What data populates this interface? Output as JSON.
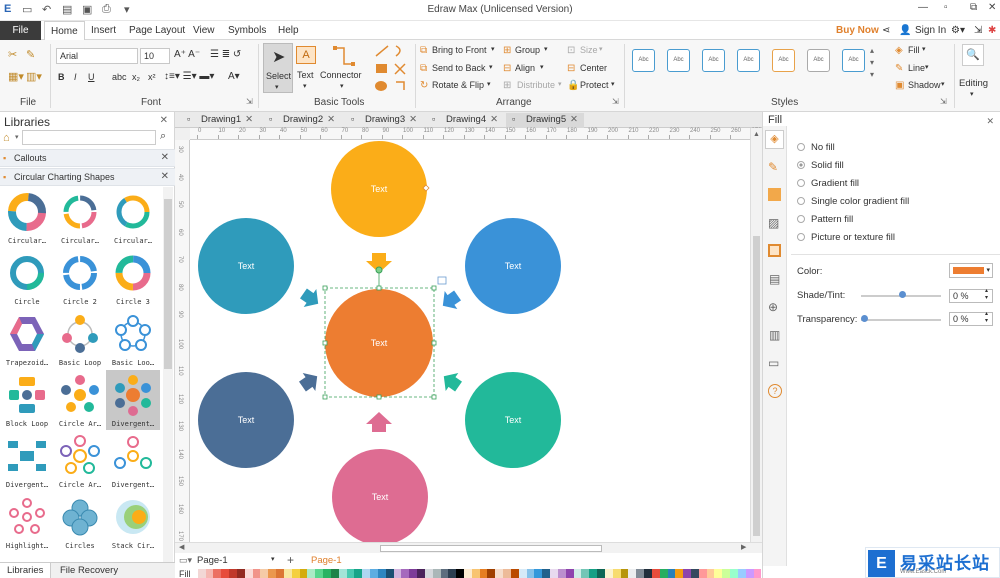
{
  "window": {
    "title": "Edraw Max (Unlicensed Version)"
  },
  "menu": {
    "file": "File",
    "items": [
      "Home",
      "Insert",
      "Page Layout",
      "View",
      "Symbols",
      "Help"
    ],
    "buy_now": "Buy Now",
    "sign_in": "Sign In"
  },
  "ribbon": {
    "font_name": "Arial",
    "font_size": "10",
    "group_file": "File",
    "group_font": "Font",
    "group_basic_tools": "Basic Tools",
    "group_arrange": "Arrange",
    "group_styles": "Styles",
    "group_editing": "Editing",
    "select": "Select",
    "text": "Text",
    "connector": "Connector",
    "bring_to_front": "Bring to Front",
    "send_to_back": "Send to Back",
    "rotate_flip": "Rotate & Flip",
    "group": "Group",
    "align": "Align",
    "distribute": "Distribute",
    "size": "Size",
    "center": "Center",
    "protect": "Protect",
    "fill": "Fill",
    "line": "Line",
    "shadow": "Shadow",
    "style_sample": "Abc",
    "style_colors": [
      "#4a9cd0",
      "#4a9cd0",
      "#4a9cd0",
      "#e8a24a",
      "#aaaaaa",
      "#4a9cd0"
    ]
  },
  "libraries": {
    "title": "Libraries",
    "search_placeholder": "",
    "sections": [
      "Callouts",
      "Circular Charting Shapes"
    ],
    "shapes": [
      {
        "label": "Circular…",
        "icon": "circular-1-icon"
      },
      {
        "label": "Circular…",
        "icon": "circular-2-icon"
      },
      {
        "label": "Circular…",
        "icon": "circular-3-icon"
      },
      {
        "label": "Circle",
        "icon": "circle-icon"
      },
      {
        "label": "Circle 2",
        "icon": "circle-2-icon"
      },
      {
        "label": "Circle 3",
        "icon": "circle-3-icon"
      },
      {
        "label": "Trapezoid…",
        "icon": "trapezoid-icon"
      },
      {
        "label": "Basic Loop",
        "icon": "basic-loop-icon"
      },
      {
        "label": "Basic Loo…",
        "icon": "basic-loop-2-icon"
      },
      {
        "label": "Block Loop",
        "icon": "block-loop-icon"
      },
      {
        "label": "Circle Ar…",
        "icon": "circle-arrows-icon"
      },
      {
        "label": "Divergent…",
        "icon": "divergent-icon",
        "selected": true
      },
      {
        "label": "Divergent…",
        "icon": "divergent-2-icon"
      },
      {
        "label": "Circle Ar…",
        "icon": "circle-arrows-2-icon"
      },
      {
        "label": "Divergent…",
        "icon": "divergent-3-icon"
      },
      {
        "label": "Highlight…",
        "icon": "highlight-icon"
      },
      {
        "label": "Circles",
        "icon": "circles-icon"
      },
      {
        "label": "Stack Cir…",
        "icon": "stack-circles-icon"
      }
    ],
    "bottom_tabs": [
      "Libraries",
      "File Recovery"
    ]
  },
  "tabs": [
    "Drawing1",
    "Drawing2",
    "Drawing3",
    "Drawing4",
    "Drawing5"
  ],
  "active_tab": "Drawing5",
  "ruler_h": [
    "0",
    "10",
    "20",
    "30",
    "40",
    "50",
    "60",
    "70",
    "80",
    "90",
    "100",
    "110",
    "120",
    "130",
    "140",
    "150",
    "160",
    "170",
    "180",
    "190",
    "200",
    "210",
    "220",
    "230",
    "240",
    "250",
    "260",
    "270"
  ],
  "ruler_v": [
    "30",
    "40",
    "50",
    "60",
    "70",
    "80",
    "90",
    "100",
    "110",
    "120",
    "130",
    "140",
    "150",
    "160",
    "170"
  ],
  "diagram": {
    "text": "Text",
    "circles": [
      {
        "name": "top",
        "color": "#fbad18"
      },
      {
        "name": "top-left",
        "color": "#2f9bbb"
      },
      {
        "name": "top-right",
        "color": "#3a92d8"
      },
      {
        "name": "center",
        "color": "#ed7d31"
      },
      {
        "name": "bottom-left",
        "color": "#4b6e96"
      },
      {
        "name": "bottom-right",
        "color": "#22b99a"
      },
      {
        "name": "bottom",
        "color": "#de6c92"
      }
    ]
  },
  "page": {
    "page_label": "Page-1",
    "active_page": "Page-1",
    "fill_label": "Fill"
  },
  "fill_panel": {
    "title": "Fill",
    "options": [
      "No fill",
      "Solid fill",
      "Gradient fill",
      "Single color gradient fill",
      "Pattern fill",
      "Picture or texture fill"
    ],
    "selected": "Solid fill",
    "color_label": "Color:",
    "color_value": "#ed7d31",
    "shade_label": "Shade/Tint:",
    "shade_value": "0 %",
    "transparency_label": "Transparency:",
    "transparency_value": "0 %"
  },
  "watermark": {
    "text": "易采站长站",
    "sub": "Www.Easck.Com"
  }
}
